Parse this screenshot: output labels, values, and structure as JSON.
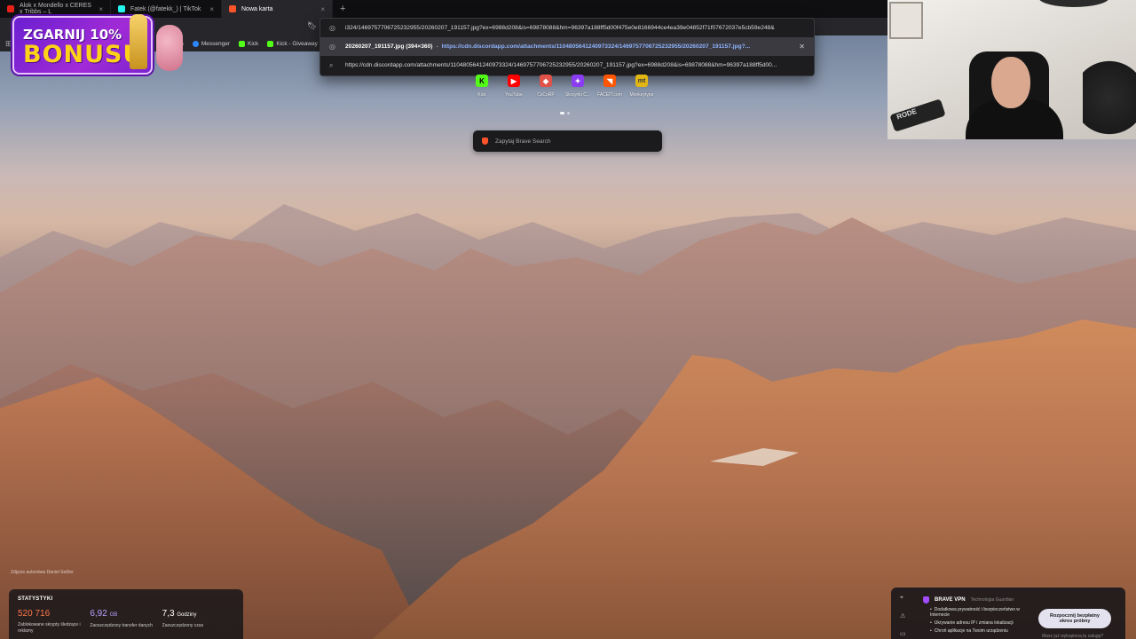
{
  "tabs": [
    {
      "label": "Alok x Mondello x CERES x Tribbs – L",
      "favicon_color": "#e62117",
      "active": false
    },
    {
      "label": "Fatek (@fatekk_) | TikTok",
      "favicon_color": "#25f4ee",
      "active": false
    },
    {
      "label": "Nowa karta",
      "favicon_color": "#fb542b",
      "active": true
    }
  ],
  "new_tab_symbol": "+",
  "toolbar": {
    "bookmark_icon": "bookmark-icon"
  },
  "bookmarks": [
    {
      "label": "Messenger",
      "color": "#2d88ff"
    },
    {
      "label": "Kick",
      "color": "#53fc18"
    },
    {
      "label": "Kick - Giveaway",
      "color": "#53fc18"
    }
  ],
  "bookmark_partial": "as",
  "omnibox": {
    "input_value": "i324/1469757706725232955/20260207_191157.jpg?ex=6988d208&is=69878088&hm=96397a188ff5d00f475e0e8166944ce4ea39e04852f71f07672037e5cb59e248&",
    "suggestion_file": "20260207_191157.jpg (394×360)",
    "suggestion_separator": " - ",
    "suggestion_url": "https://cdn.discordapp.com/attachments/1104805641240973324/1469757706725232955/20260207_191157.jpg?...",
    "search_text": "https://cdn.discordapp.com/attachments/1104805641240973324/1469757706725232955/20260207_191157.jpg?ex=6988d208&is=69878088&hm=96397a188ff5d00..."
  },
  "promo": {
    "line1": "ZGARNIJ 10%",
    "line2": "BONUSU"
  },
  "webcam": {
    "mic_label": "RODE"
  },
  "top_sites": [
    {
      "label": "Kick",
      "glyph": "K",
      "color": "#53fc18",
      "text_color": "#000"
    },
    {
      "label": "YouTube",
      "glyph": "▶",
      "color": "#ff0000",
      "text_color": "#fff"
    },
    {
      "label": "CsCoRP",
      "glyph": "◆",
      "color": "#e0524a",
      "text_color": "#fff"
    },
    {
      "label": "Skrzynki C...",
      "glyph": "✦",
      "color": "#8a3df0",
      "text_color": "#fff"
    },
    {
      "label": "FACEIT.com",
      "glyph": "◥",
      "color": "#ff5500",
      "text_color": "#fff"
    },
    {
      "label": "Monkeytype",
      "glyph": "mt",
      "color": "#e2b714",
      "text_color": "#323437"
    }
  ],
  "search": {
    "placeholder": "Zapytaj Brave Search"
  },
  "photo_credit": "Zdjęcie autorstwa Daniel Seßler",
  "stats": {
    "title": "STATYSTYKI",
    "items": [
      {
        "value": "520 716",
        "unit": "",
        "desc": "Zablokowane skrypty śledzące i reklamy"
      },
      {
        "value": "6,92",
        "unit": "GB",
        "desc": "Zaoszczędzony transfer danych"
      },
      {
        "value": "7,3",
        "unit": "Godziny",
        "desc": "Zaoszczędzony czas"
      }
    ]
  },
  "vpn": {
    "name": "BRAVE VPN",
    "tech": "Technologia Guardian",
    "features": [
      "Dodatkowa prywatność i bezpieczeństwo w Internecie",
      "Ukrywanie adresu IP i zmiana lokalizacji",
      "Chroń aplikacje na Twoim urządzeniu"
    ],
    "cta": "Rozpocznij bezpłatny okres próbny",
    "already": "Masz już wykupioną tę usługę?"
  }
}
